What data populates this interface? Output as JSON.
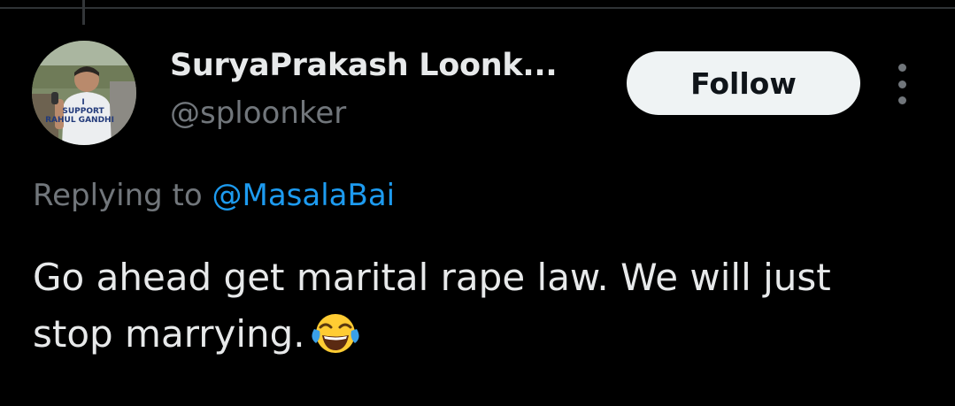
{
  "tweet": {
    "author": {
      "display_name": "SuryaPrakash Loonk...",
      "handle": "@sploonker",
      "avatar_caption_lines": [
        "I",
        "SUPPORT",
        "RAHUL GANDHI"
      ]
    },
    "follow_label": "Follow",
    "more_icon": "more-vertical-icon",
    "replying_prefix": "Replying to",
    "replying_to": "@MasalaBai",
    "text": "Go ahead get marital rape law. We will just stop marrying.",
    "emoji": "face-with-tears-of-joy"
  },
  "colors": {
    "background": "#000000",
    "primary_text": "#e7e9ea",
    "secondary_text": "#71767b",
    "link": "#1d9bf0",
    "follow_bg": "#eff3f4",
    "follow_text": "#0f1419"
  }
}
